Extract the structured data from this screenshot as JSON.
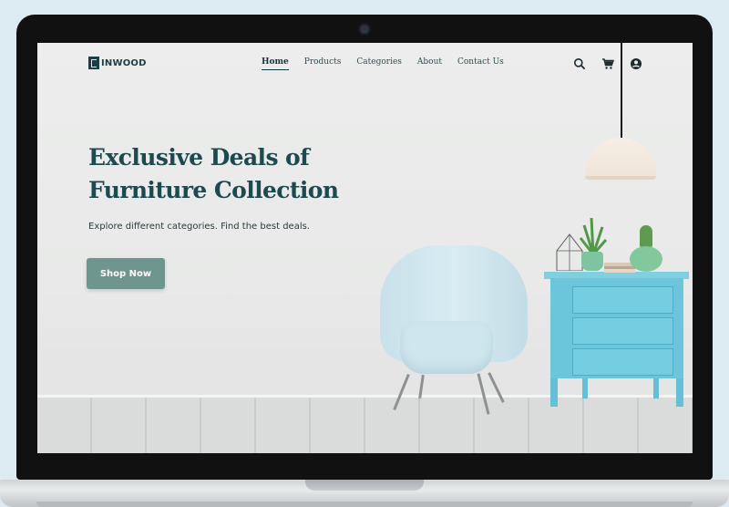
{
  "brand": {
    "name": "INWOOD"
  },
  "nav": {
    "items": [
      {
        "label": "Home",
        "active": true
      },
      {
        "label": "Products",
        "active": false
      },
      {
        "label": "Categories",
        "active": false
      },
      {
        "label": "About",
        "active": false
      },
      {
        "label": "Contact Us",
        "active": false
      }
    ],
    "icons": [
      "search-icon",
      "cart-icon",
      "user-account-icon"
    ]
  },
  "hero": {
    "title_line1": "Exclusive Deals of",
    "title_line2": "Furniture Collection",
    "subtitle": "Explore different categories. Find the best deals.",
    "cta_label": "Shop Now"
  },
  "colors": {
    "primary_dark": "#1c4a4e",
    "button": "#6f968e",
    "accent_cabinet": "#6bc6db",
    "chair": "#cfe6ee",
    "background": "#ecedec"
  }
}
